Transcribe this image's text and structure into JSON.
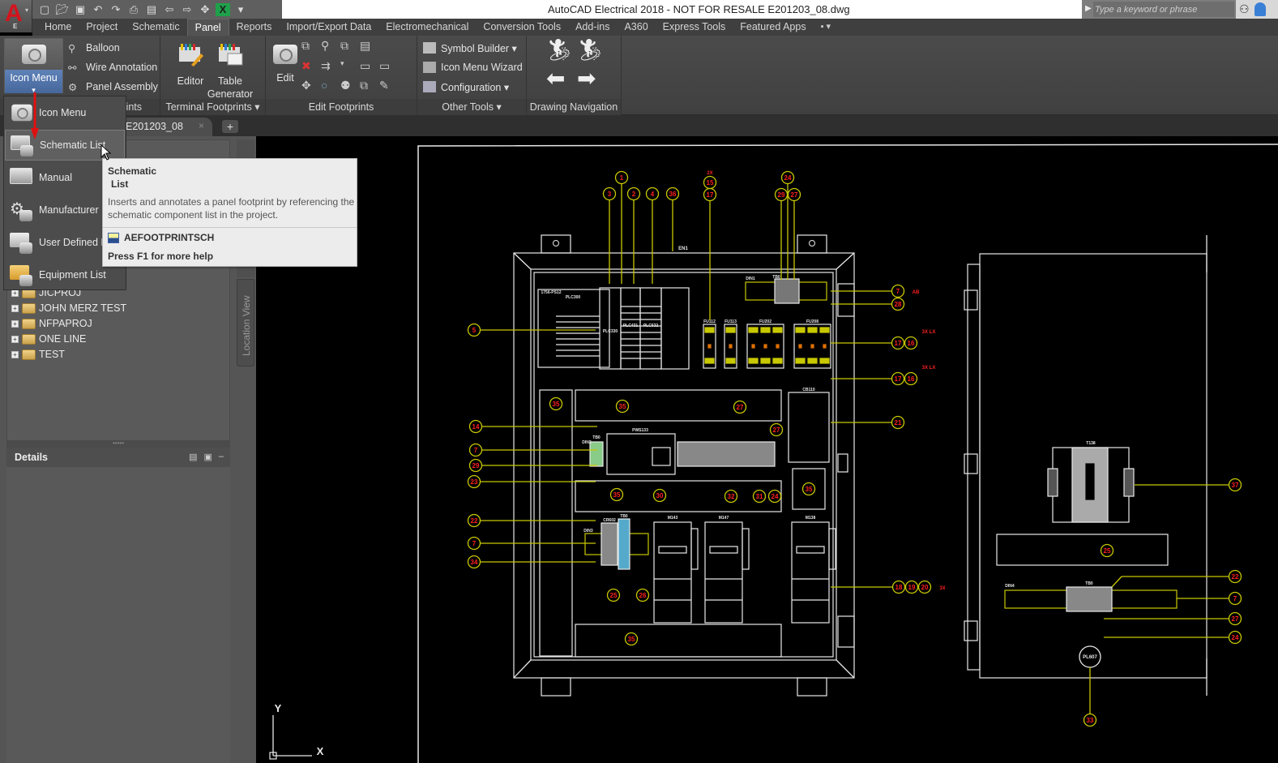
{
  "titlebar": {
    "title": "AutoCAD Electrical 2018 - NOT FOR RESALE    E201203_08.dwg",
    "logo_letter": "A",
    "logo_sub": "E",
    "search_placeholder": "Type a keyword or phrase",
    "qat_icons": [
      "new-icon",
      "open-icon",
      "save-icon",
      "undo-icon",
      "redo-icon",
      "plot-icon",
      "sheet-icon",
      "back-icon",
      "forward-icon",
      "surf-icon",
      "excel-icon",
      "customize-icon"
    ]
  },
  "ribbon_tabs": [
    "Home",
    "Project",
    "Schematic",
    "Panel",
    "Reports",
    "Import/Export Data",
    "Electromechanical",
    "Conversion Tools",
    "Add-ins",
    "A360",
    "Express Tools",
    "Featured Apps",
    "▪ ▾"
  ],
  "active_tab": "Panel",
  "ribbon": {
    "icon_menu": {
      "label": "Icon Menu",
      "caret": "▾"
    },
    "insert_items": [
      "Balloon",
      "Wire Annotation",
      "Panel Assembly"
    ],
    "insert_panel_title": "Insert Component Footprints",
    "insert_panel_title_visible": "rints",
    "terminal": {
      "buttons": [
        "Editor",
        "Table Generator"
      ],
      "table_line1": "Table",
      "table_line2": "Generator",
      "title": "Terminal Footprints ▾"
    },
    "edit": {
      "button": "Edit",
      "title": "Edit Footprints"
    },
    "other_tools": {
      "items": [
        "Symbol Builder ▾",
        "Icon Menu  Wizard",
        "Configuration ▾"
      ],
      "title": "Other Tools ▾"
    },
    "navigation": {
      "title": "Drawing Navigation"
    }
  },
  "doc_tab": {
    "label": "E201203_08",
    "close": "×",
    "new": "+"
  },
  "dropdown": {
    "items": [
      {
        "label": "Icon Menu",
        "icon": "icon-menu-icon"
      },
      {
        "label": "Schematic  List",
        "icon": "schematic-list-icon",
        "hover": true
      },
      {
        "label": "Manual",
        "icon": "manual-icon"
      },
      {
        "label": "Manufacturer  M",
        "icon": "manufacturer-menu-icon"
      },
      {
        "label": "User Defined Lis",
        "icon": "user-defined-list-icon"
      },
      {
        "label": "Equipment  List",
        "icon": "equipment-list-icon"
      }
    ]
  },
  "tooltip": {
    "title_line1": "Schematic",
    "title_line2": "List",
    "description": "Inserts and annotates a panel footprint by referencing the schematic component list in the project.",
    "command": "AEFOOTPRINTSCH",
    "help": "Press F1 for more help"
  },
  "project_tree": [
    "JICPROJ",
    "JOHN MERZ TEST",
    "NFPAPROJ",
    "ONE LINE",
    "TEST"
  ],
  "details": {
    "title": "Details",
    "collapse": "–"
  },
  "location_view": "Location View",
  "drawing": {
    "top_balloons": [
      "1",
      "3",
      "2",
      "4",
      "36",
      "15",
      "17",
      "24",
      "29",
      "27"
    ],
    "top_balloon_note": "2X",
    "labels": {
      "enclosure": "EN1",
      "plc_rack": "1756-PS12",
      "plc": "PLC300",
      "plc_cpu": "PLC330",
      "plc_mod1": "PLC431",
      "plc_mod2": "PLC532",
      "fuses": [
        "FU112",
        "FU113",
        "FU202",
        "FU208"
      ],
      "din1": "DIN1",
      "tb0": "TB0",
      "cb": "CB110",
      "ps": "PWS133",
      "din2": "DIN2",
      "tb2": "TB0",
      "din3": "DIN3",
      "tb3": "TB0",
      "cr": "CR602",
      "motors": [
        "M143",
        "M147",
        "M138"
      ],
      "transformer": "T138",
      "din4": "DIN4",
      "tb4": "TB0",
      "pilot": "PL607"
    },
    "left_balloons": [
      "5",
      "14",
      "7",
      "29",
      "23",
      "22",
      "7",
      "34"
    ],
    "inner_balloons": [
      "35",
      "35",
      "27",
      "27",
      "30",
      "32",
      "31",
      "24",
      "35",
      "35",
      "25",
      "26",
      "35",
      "25"
    ],
    "right_balloons": [
      {
        "nums": [
          "7"
        ],
        "note": "AB"
      },
      {
        "nums": [
          "28"
        ],
        "note": ""
      },
      {
        "nums": [
          "17",
          "16"
        ],
        "note": "3X  LX"
      },
      {
        "nums": [
          "17",
          "16"
        ],
        "note": "3X  LX"
      },
      {
        "nums": [
          "21"
        ],
        "note": ""
      },
      {
        "nums": [
          "18",
          "19",
          "20"
        ],
        "note": "3X"
      }
    ],
    "side_balloons": [
      "37",
      "22",
      "7",
      "27",
      "24",
      "33"
    ],
    "ucs": {
      "x": "X",
      "y": "Y"
    }
  },
  "colors": {
    "balloon": "#c8c800",
    "balloon_text": "#ff2020",
    "geometry": "#e8e8e8",
    "active_button": "#5577aa",
    "arrow": "#e01010"
  }
}
